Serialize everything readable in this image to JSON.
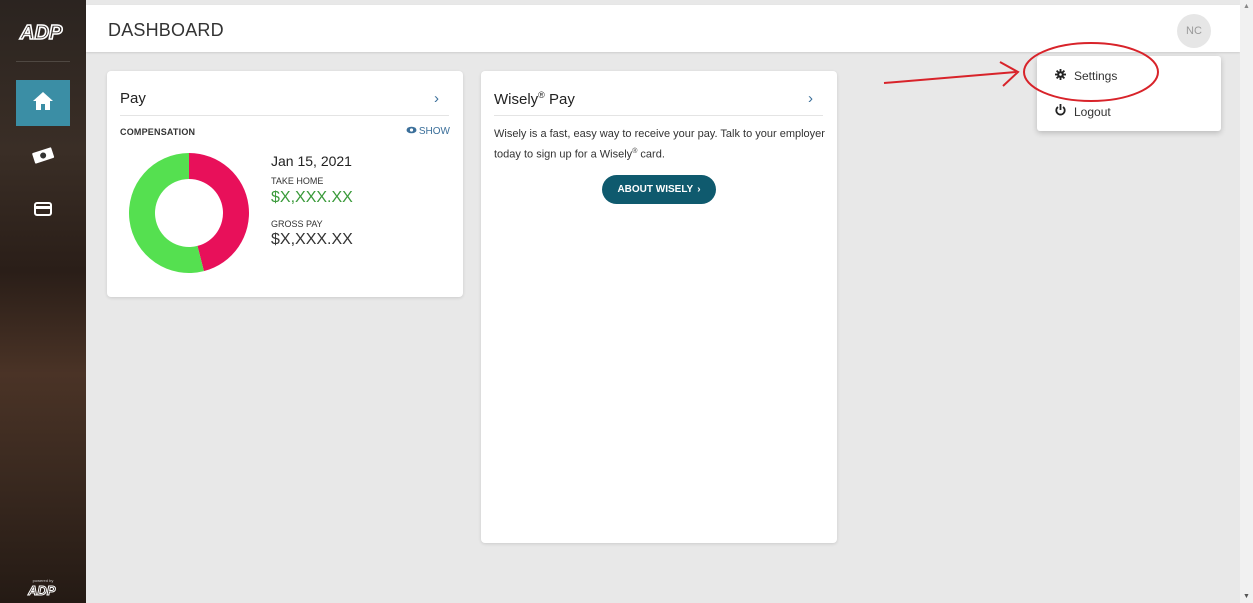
{
  "app": {
    "logo_text": "ADP",
    "powered_by": "powered by",
    "powered_logo": "ADP"
  },
  "header": {
    "title": "DASHBOARD",
    "avatar_initials": "NC"
  },
  "sidebar": {
    "items": [
      {
        "name": "home",
        "icon": "home-icon",
        "active": true
      },
      {
        "name": "pay",
        "icon": "money-icon",
        "active": false
      },
      {
        "name": "card",
        "icon": "credit-card-icon",
        "active": false
      }
    ]
  },
  "pay_card": {
    "title": "Pay",
    "compensation_label": "COMPENSATION",
    "show_label": "SHOW",
    "date": "Jan 15, 2021",
    "take_home_label": "TAKE HOME",
    "take_home_value": "$X,XXX.XX",
    "gross_pay_label": "GROSS PAY",
    "gross_pay_value": "$X,XXX.XX",
    "donut": {
      "take_home_fraction": 0.54,
      "colors": {
        "take_home": "#55e050",
        "deductions": "#e8105a"
      }
    }
  },
  "wisely_card": {
    "title": "Wisely",
    "title_mark": "®",
    "title_suffix": " Pay",
    "text_part1": "Wisely is a fast, easy way to receive your pay. Talk to your employer today to sign up for a Wisely",
    "text_mark": "®",
    "text_part2": " card.",
    "button_label": "ABOUT WISELY"
  },
  "user_menu": {
    "items": [
      {
        "label": "Settings",
        "icon": "gear-icon"
      },
      {
        "label": "Logout",
        "icon": "power-icon"
      }
    ]
  },
  "colors": {
    "accent": "#3b8ea5",
    "button": "#0f5a6e",
    "annotation": "#d8232a"
  }
}
